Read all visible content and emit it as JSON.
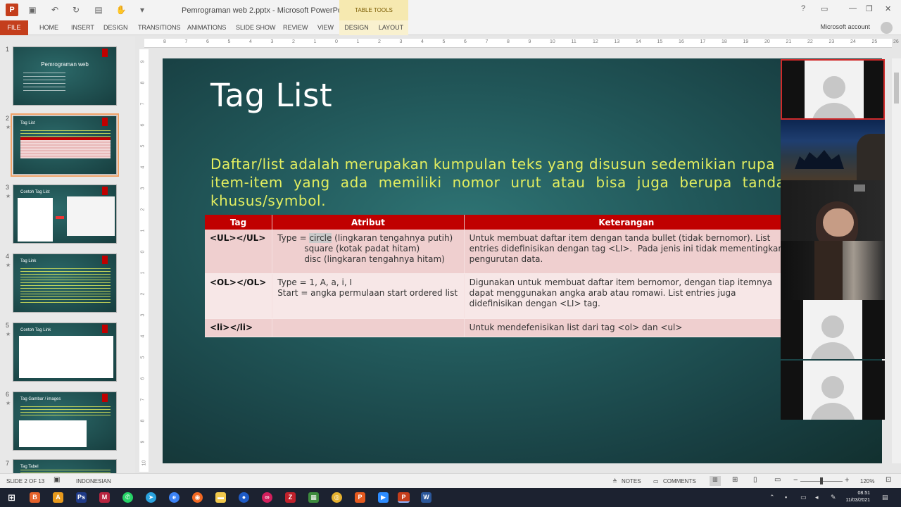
{
  "window": {
    "title": "Pemrograman web 2.pptx - Microsoft PowerPoint",
    "context_tab": "TABLE TOOLS",
    "account": "Microsoft account"
  },
  "ribbon": {
    "tabs": [
      "FILE",
      "HOME",
      "INSERT",
      "DESIGN",
      "TRANSITIONS",
      "ANIMATIONS",
      "SLIDE SHOW",
      "REVIEW",
      "VIEW",
      "DESIGN",
      "LAYOUT"
    ]
  },
  "ruler": {
    "h": [
      "8",
      "7",
      "6",
      "5",
      "4",
      "3",
      "2",
      "1",
      "0",
      "1",
      "2",
      "3",
      "4",
      "5",
      "6",
      "7",
      "8",
      "9",
      "10",
      "11",
      "12",
      "13",
      "14",
      "15",
      "16",
      "17",
      "18",
      "19",
      "20",
      "21",
      "22",
      "23",
      "24",
      "25",
      "26",
      "27"
    ],
    "v": [
      "9",
      "8",
      "7",
      "6",
      "5",
      "4",
      "3",
      "2",
      "1",
      "0",
      "1",
      "2",
      "3",
      "4",
      "5",
      "6",
      "7",
      "8",
      "9",
      "10"
    ]
  },
  "thumbnails": [
    {
      "num": "1",
      "title": "Pemrograman web"
    },
    {
      "num": "2",
      "title": "Tag List"
    },
    {
      "num": "3",
      "title": "Contoh Tag List"
    },
    {
      "num": "4",
      "title": "Tag Link"
    },
    {
      "num": "5",
      "title": "Contoh Tag Link"
    },
    {
      "num": "6",
      "title": "Tag Gambar / images"
    },
    {
      "num": "7",
      "title": "Tag Tabel"
    }
  ],
  "slide": {
    "title": "Tag List",
    "body_lines": [
      "Daftar/list adalah merupakan kumpulan teks yang disusun sedemikian rupa sehingga",
      "item-item yang ada memiliki nomor urut atau bisa juga berupa tanda",
      "khusus/symbol."
    ],
    "table": {
      "headers": [
        "Tag",
        "Atribut",
        "Keterangan"
      ],
      "rows": [
        {
          "tag": "<UL></UL>",
          "attr_prefix": "Type = ",
          "attr_highlight": "circle",
          "attr_rest": " (lingkaran tengahnya putih)\n          square (kotak padat hitam)\n          disc (lingkaran tengahnya hitam)",
          "desc": "Untuk membuat daftar item dengan tanda bullet (tidak bernomor). List\nentries didefinisikan dengan tag <LI>.  Pada jenis ini tidak mementingkan\npengurutan data."
        },
        {
          "tag": "<OL></OL>",
          "attr": "Type = 1, A, a, i, I\nStart = angka permulaan start ordered list",
          "desc": "Digunakan untuk membuat daftar item bernomor, dengan tiap itemnya\ndapat menggunakan angka arab atau romawi. List entries juga\ndidefinisikan dengan <LI> tag."
        },
        {
          "tag": "<li></li>",
          "attr": "",
          "desc": "Untuk mendefenisikan list dari tag <ol> dan <ul>"
        }
      ]
    }
  },
  "statusbar": {
    "slide_info": "SLIDE 2 OF 13",
    "language": "INDONESIAN",
    "notes": "NOTES",
    "comments": "COMMENTS",
    "zoom": "120%"
  },
  "taskbar": {
    "time": "08.51",
    "date": "11/03/2021"
  },
  "colors": {
    "accent": "#c43e1c",
    "slide_text_yellow": "#e3ee5f",
    "table_header": "#c00000"
  }
}
